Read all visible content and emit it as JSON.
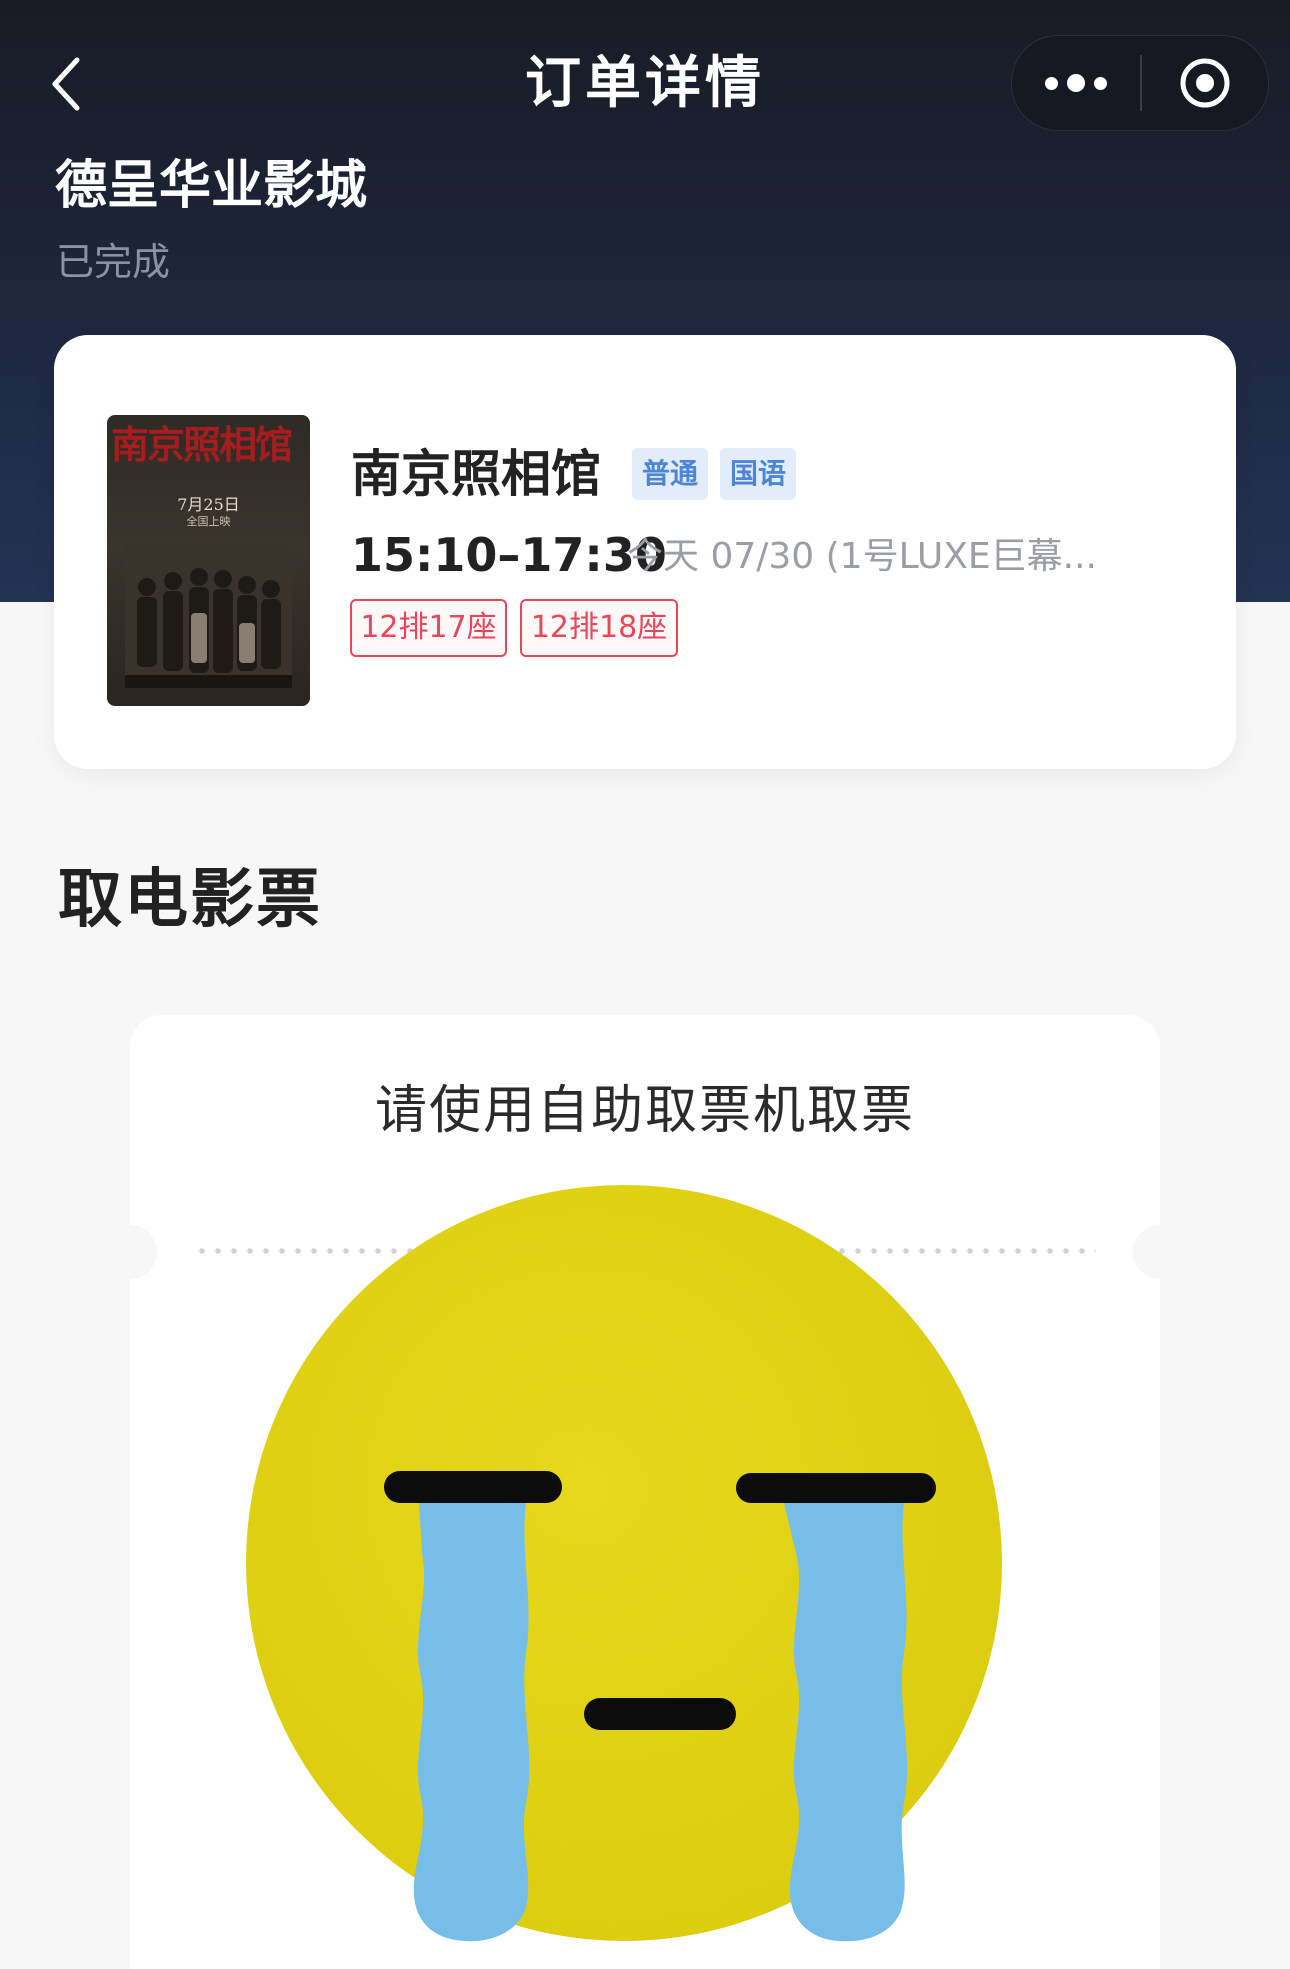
{
  "nav": {
    "title": "订单详情",
    "back_icon": "chevron-left-icon",
    "more_icon": "more-dots-icon",
    "close_icon": "target-circle-icon"
  },
  "order": {
    "cinema_name": "德呈华业影城",
    "status": "已完成"
  },
  "movie": {
    "title": "南京照相馆",
    "tags": [
      "普通",
      "国语"
    ],
    "showtime": "15:10–17:30",
    "show_info": "今天 07/30 (1号LUXE巨幕...",
    "seats": [
      "12排17座",
      "12排18座"
    ],
    "poster": {
      "title": "南京照相馆",
      "date": "7月25日",
      "subtitle": "全国上映"
    }
  },
  "ticket": {
    "section_title": "取电影票",
    "prompt": "请使用自助取票机取票",
    "emoji_icon": "crying-face-icon"
  },
  "colors": {
    "header_dark": "#191c26",
    "seat_red": "#e8475a",
    "tag_blue": "#4d86d6",
    "emoji_yellow": "#e2d516",
    "tear_blue": "#76bde8"
  }
}
